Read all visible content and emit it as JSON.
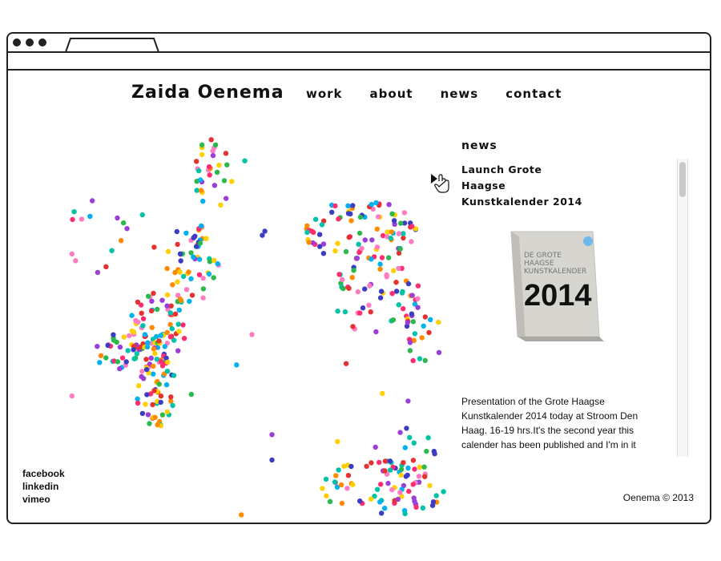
{
  "site": {
    "title": "Zaida Oenema",
    "nav": [
      {
        "label": "work"
      },
      {
        "label": "about"
      },
      {
        "label": "news"
      },
      {
        "label": "contact"
      }
    ],
    "social": [
      {
        "label": "facebook"
      },
      {
        "label": "linkedin"
      },
      {
        "label": "vimeo"
      }
    ],
    "news": {
      "heading": "news",
      "article_title": "Launch Grote Haagse Kunstkalender 2014",
      "article_body": "Presentation of the Grote Haagse Kunstkalender 2014 today at Stroom Den Haag. 16-19 hrs.It's the second year this calender has been published and I'm in it",
      "calendar": {
        "line1": "DE GROTE",
        "line2": "HAAGSE",
        "line3": "KUNSTKALENDER",
        "year": "2014"
      }
    },
    "footer": "Oenema © 2013"
  },
  "colors": {
    "dot_palette": [
      "#ff2d6f",
      "#ffd000",
      "#00b1f0",
      "#2bb94b",
      "#9b3dd6",
      "#ff8a00",
      "#3c3cc4",
      "#ff7cc2",
      "#00c2a8",
      "#e5312f"
    ]
  },
  "icons": {
    "browser_dots": "window-control-icon",
    "cursor": "hand-pointer-icon",
    "play": "play-arrow-icon"
  }
}
